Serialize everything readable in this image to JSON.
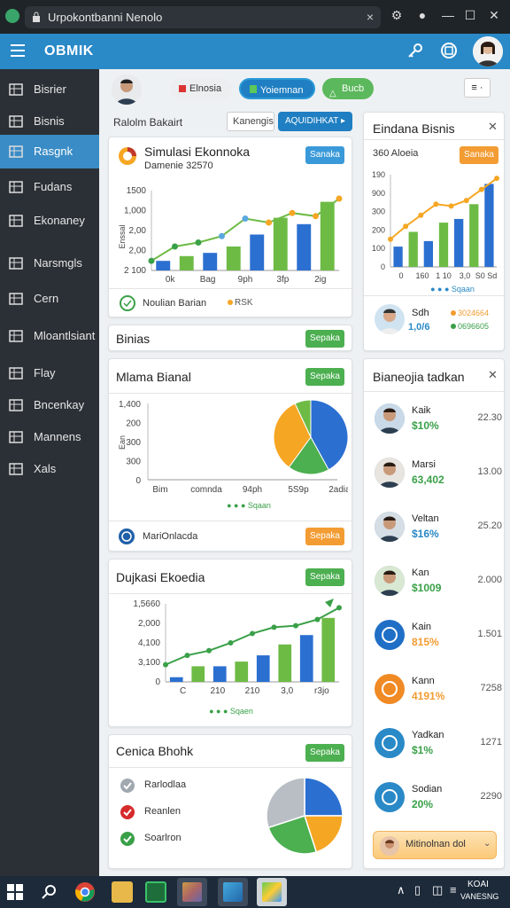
{
  "window": {
    "title": "Urpokontbanni Nenolo",
    "close": "×",
    "controls": [
      "⚙",
      "●",
      "—",
      "☐",
      "✕"
    ]
  },
  "appbar": {
    "brand": "OBMIK"
  },
  "sidebar": {
    "items": [
      {
        "label": "Bisrier",
        "icon": "list-icon"
      },
      {
        "label": "Bisnis",
        "icon": "eye-icon"
      },
      {
        "label": "Rasgnk",
        "icon": "user-icon",
        "active": true
      },
      {
        "label": "Fudans",
        "icon": "grid-icon"
      },
      {
        "label": "Ekonaney",
        "icon": "image-icon"
      },
      {
        "label": "Narsmgls",
        "icon": "tools-icon"
      },
      {
        "label": "Cern",
        "icon": "table-icon"
      },
      {
        "label": "Mloantlsiant",
        "icon": "wrench-icon"
      },
      {
        "label": "Flay",
        "icon": "building-icon"
      },
      {
        "label": "Bncenkay",
        "icon": "dial-icon"
      },
      {
        "label": "Mannens",
        "icon": "globe-icon"
      },
      {
        "label": "Xals",
        "icon": "columns-icon"
      }
    ]
  },
  "topbar": {
    "pills": [
      "Elnosia",
      "Yoiemnan",
      "Bucb"
    ],
    "menu": "≡ ·"
  },
  "filter": {
    "label": "Ralolm Bakairt",
    "input_value": "Kanengis",
    "button": "AQUIDIHKAT ▸"
  },
  "cards": {
    "simulasi": {
      "title": "Simulasi Ekonnoka",
      "subtitle": "Damenie 32570",
      "button": "Sanaka",
      "footer_left": "Noulian Barian",
      "footer_right": "RSK"
    },
    "bisnis": {
      "title": "Binias",
      "button": "Sepaka"
    },
    "mlama": {
      "title": "Mlama Bianal",
      "button": "Sepaka",
      "legend": "Sqaan",
      "footer": "MariOnlacda",
      "footer_button": "Sepaka"
    },
    "dujkasi": {
      "title": "Dujkasi Ekoedia",
      "button": "Sepaka",
      "legend": "Sqaen"
    },
    "cenica": {
      "title": "Cenica Bhohk",
      "button": "Sepaka",
      "items": [
        "Rarlodlaa",
        "Reanlen",
        "Soarlron"
      ]
    },
    "eindana": {
      "title": "Eindana Bisnis",
      "subtitle": "360 Aloeia",
      "button": "Sanaka",
      "close": "✕",
      "legend": "Sqaan",
      "person_name": "Sdh",
      "person_value": "1,0/6",
      "stat_a": "3024664",
      "stat_b": "0696605"
    },
    "bianeojia": {
      "title": "Bianeojia tadkan",
      "close": "✕",
      "footer": "Mitinolnan dol"
    }
  },
  "people": [
    {
      "name": "Kaik",
      "value": "$10%",
      "num": "22.30",
      "color": "#3aa048"
    },
    {
      "name": "Marsi",
      "value": "63,402",
      "num": "13.00",
      "color": "#3aa048"
    },
    {
      "name": "Veltan",
      "value": "$16%",
      "num": "25.20",
      "color": "#2a89c7"
    },
    {
      "name": "Kan",
      "value": "$1009",
      "num": "2.000",
      "color": "#3aa048"
    },
    {
      "name": "Kain",
      "value": "815%",
      "num": "1.501",
      "color": "#f39c33"
    },
    {
      "name": "Kann",
      "value": "4191%",
      "num": "7258",
      "color": "#f39c33"
    },
    {
      "name": "Yadkan",
      "value": "$1%",
      "num": "1271",
      "color": "#3aa048"
    },
    {
      "name": "Sodian",
      "value": "20%",
      "num": "2290",
      "color": "#3aa048"
    }
  ],
  "chart1": {
    "yticks": [
      "1500",
      "1,000",
      "2,00",
      "2,00",
      "2 100"
    ],
    "xticks": [
      "0k",
      "Bag",
      "9ph",
      "3fp",
      "2ig"
    ],
    "ylabel": "Enssal",
    "bars": [
      0.12,
      0.18,
      0.22,
      0.3,
      0.45,
      0.66,
      0.58,
      0.86
    ],
    "line": [
      0.12,
      0.3,
      0.35,
      0.43,
      0.65,
      0.6,
      0.72,
      0.68,
      0.9
    ],
    "colors": [
      "#2b6fd1",
      "#6dbb45"
    ]
  },
  "chart2": {
    "yticks": [
      "1,400",
      "200",
      "300",
      "300",
      "0"
    ],
    "xticks": [
      "Bim",
      "comnda",
      "94ph",
      "5S9p",
      "2adiaga"
    ],
    "ylabel": "Ean",
    "pie": [
      0.42,
      0.18,
      0.33,
      0.07
    ],
    "pie_colors": [
      "#2b6fd1",
      "#4caf50",
      "#f5a623",
      "#6dbb45"
    ]
  },
  "chart3": {
    "yticks": [
      "1,5660",
      "2,000",
      "4,100",
      "3,100",
      "0"
    ],
    "xticks": [
      "C",
      "210",
      "210",
      "3,0",
      "r3jo"
    ],
    "bars": [
      0.06,
      0.2,
      0.2,
      0.26,
      0.34,
      0.48,
      0.6,
      0.82
    ],
    "line": [
      0.22,
      0.34,
      0.4,
      0.5,
      0.62,
      0.7,
      0.72,
      0.8,
      0.95
    ]
  },
  "chart4": {
    "yticks": [
      "190",
      "900",
      "300",
      "200",
      "100",
      "0"
    ],
    "xticks": [
      "0",
      "160",
      "1 10",
      "3,0",
      "S0 Sd"
    ],
    "bars": [
      0.22,
      0.38,
      0.28,
      0.48,
      0.52,
      0.68,
      0.9
    ],
    "line": [
      0.3,
      0.44,
      0.56,
      0.68,
      0.66,
      0.72,
      0.84,
      0.96
    ]
  },
  "pie2": {
    "values": [
      0.25,
      0.2,
      0.25,
      0.3
    ],
    "colors": [
      "#2b6fd1",
      "#f5a623",
      "#4caf50",
      "#b8bec4"
    ]
  },
  "taskbar": {
    "clock_time": "KOAI",
    "clock_date": "VANESNG"
  }
}
